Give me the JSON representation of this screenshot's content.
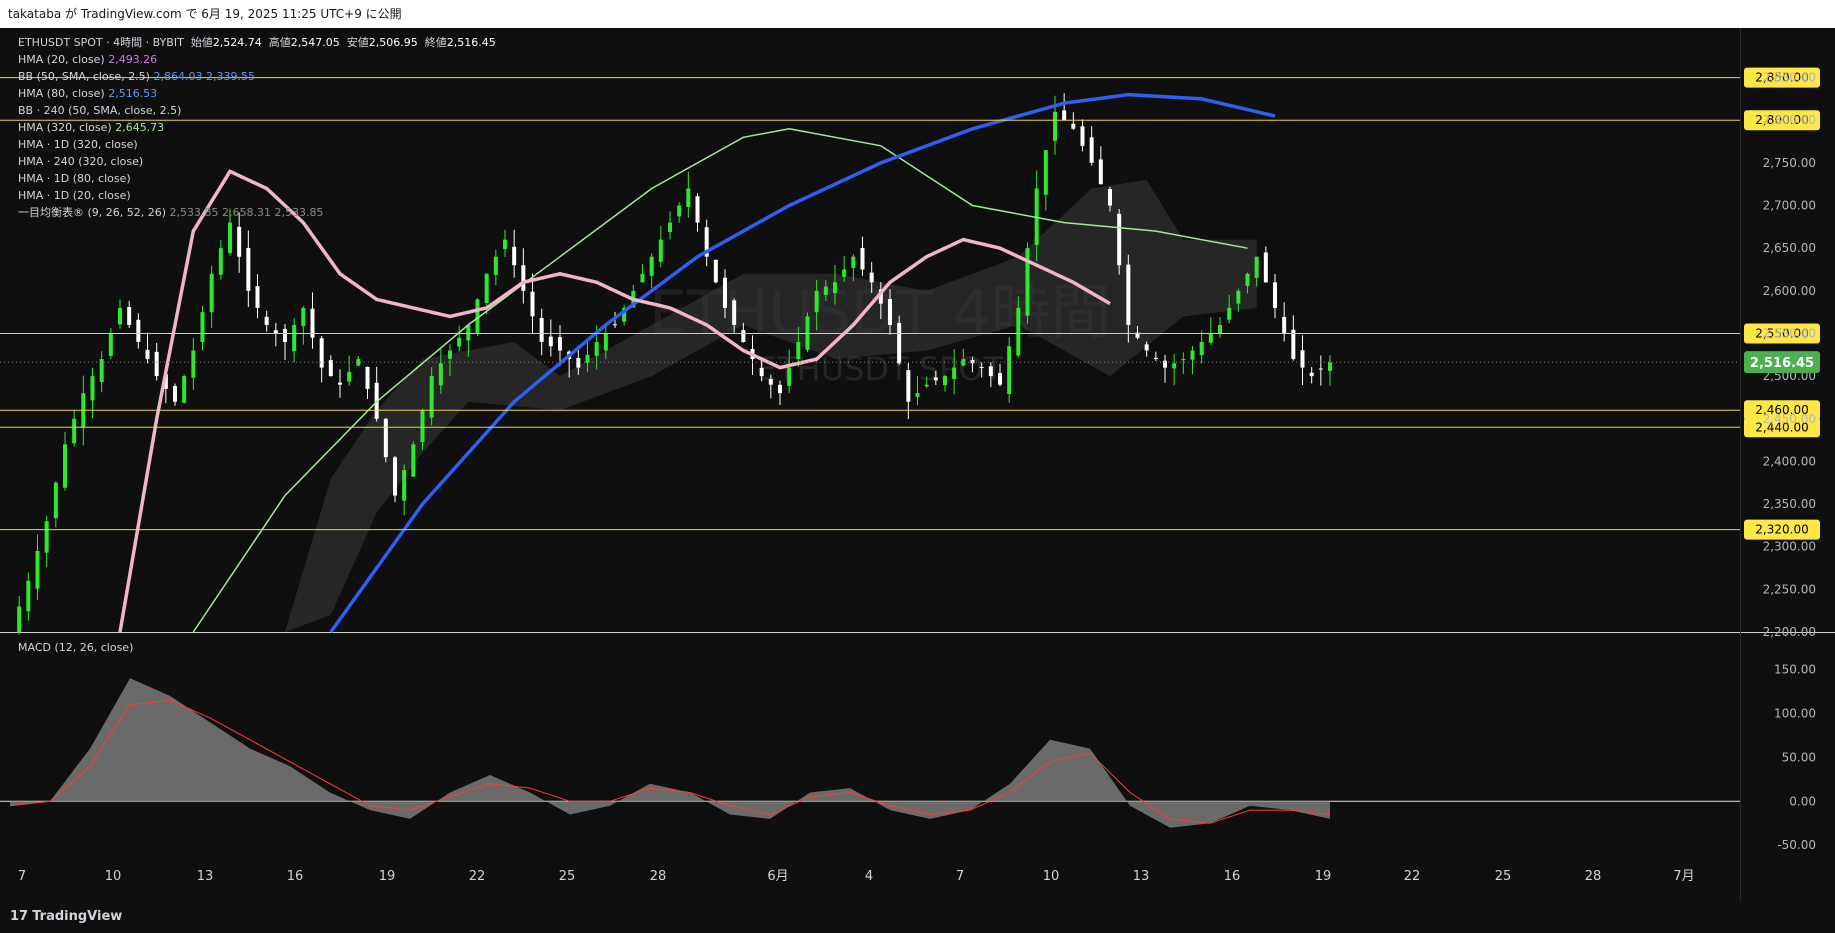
{
  "header": {
    "text": "takataba が TradingView.com で 6月 19, 2025 11:25 UTC+9 に公開"
  },
  "footer": {
    "brand": "TradingView",
    "logo": "tv-logo-icon"
  },
  "colors": {
    "background": "#0f0f0f",
    "up_candle": "#2ee82e",
    "down_candle": "#ffffff",
    "level_line": "#e8d44d",
    "level_label_bg": "#ffe745",
    "price_label_bg": "#4caf50",
    "hma20": "#c77dd9",
    "hma80": "#5b9cf0",
    "hma320": "#a5e89a",
    "hma1d320": "#2f5ff2",
    "hma1d80": "#f0b6c8",
    "bb": "#4a7ed0",
    "cloud": "#3a3a3a",
    "macd_hist": "#7a7a7a",
    "macd_signal": "#ff3b3b"
  },
  "legend": {
    "symbol": "ETHUSDT SPOT · 4時間 · BYBIT",
    "o_label": "始値",
    "o": "2,524.74",
    "h_label": "高値",
    "h": "2,547.05",
    "l_label": "安値",
    "l": "2,506.95",
    "c_label": "終値",
    "c": "2,516.45",
    "indicators": [
      {
        "name": "HMA (20, close)",
        "values": [
          "2,493.26"
        ],
        "color": "#c77dd9"
      },
      {
        "name": "BB (50, SMA, close, 2.5)",
        "values": [
          "2,864.03",
          "2,339.55"
        ],
        "color": "#5b9cf0"
      },
      {
        "name": "HMA (80, close)",
        "values": [
          "2,516.53"
        ],
        "color": "#5b9cf0"
      },
      {
        "name": "BB · 240 (50, SMA, close, 2.5)",
        "values": [],
        "color": "#5b9cf0"
      },
      {
        "name": "HMA (320, close)",
        "values": [
          "2,645.73"
        ],
        "color": "#a5e89a"
      },
      {
        "name": "HMA · 1D (320, close)",
        "values": [],
        "color": "#2f5ff2"
      },
      {
        "name": "HMA · 240 (320, close)",
        "values": [],
        "color": "#a5e89a"
      },
      {
        "name": "HMA · 1D (80, close)",
        "values": [],
        "color": "#f0b6c8"
      },
      {
        "name": "HMA · 1D (20, close)",
        "values": [],
        "color": "#c77dd9"
      },
      {
        "name": "一目均衡表® (9, 26, 52, 26)",
        "values": [
          "2,533.85",
          "2,658.31",
          "2,533.85"
        ],
        "color": "#8a8a8a"
      }
    ]
  },
  "watermark": {
    "big": "ETHUSDT 4時間",
    "small": "ETHUSDT SPOT"
  },
  "macd": {
    "title": "MACD (12, 26, close)"
  },
  "chart_data": [
    {
      "type": "candlestick",
      "title": "ETHUSDT SPOT · 4時間 · BYBIT",
      "x_labels": [
        "7",
        "10",
        "13",
        "16",
        "19",
        "22",
        "25",
        "28",
        "6月",
        "4",
        "7",
        "10",
        "13",
        "16",
        "19",
        "22",
        "25",
        "28",
        "7月"
      ],
      "y_ticks": [
        "2,200.00",
        "2,250.00",
        "2,300.00",
        "2,350.00",
        "2,400.00",
        "2,450.00",
        "2,500.00",
        "2,550.00",
        "2,600.00",
        "2,650.00",
        "2,700.00",
        "2,750.00",
        "2,800.00",
        "2,850.00"
      ],
      "ylim": [
        2200,
        2880
      ],
      "last_price": 2516.45,
      "last_price_label": "2,516.45",
      "levels": [
        {
          "value": 2850,
          "label": "2,850.00"
        },
        {
          "value": 2800,
          "label": "2,800.00"
        },
        {
          "value": 2550,
          "label": "2,550.00"
        },
        {
          "value": 2460,
          "label": "2,460.00"
        },
        {
          "value": 2440,
          "label": "2,440.00"
        },
        {
          "value": 2320,
          "label": "2,320.00"
        }
      ],
      "close_path": [
        [
          0,
          2200
        ],
        [
          2,
          2260
        ],
        [
          4,
          2330
        ],
        [
          6,
          2420
        ],
        [
          8,
          2480
        ],
        [
          10,
          2520
        ],
        [
          12,
          2580
        ],
        [
          14,
          2540
        ],
        [
          16,
          2500
        ],
        [
          18,
          2470
        ],
        [
          20,
          2530
        ],
        [
          22,
          2620
        ],
        [
          24,
          2680
        ],
        [
          26,
          2600
        ],
        [
          28,
          2560
        ],
        [
          30,
          2540
        ],
        [
          32,
          2580
        ],
        [
          34,
          2510
        ],
        [
          36,
          2490
        ],
        [
          38,
          2520
        ],
        [
          40,
          2450
        ],
        [
          42,
          2360
        ],
        [
          44,
          2420
        ],
        [
          46,
          2500
        ],
        [
          48,
          2530
        ],
        [
          50,
          2560
        ],
        [
          52,
          2620
        ],
        [
          54,
          2660
        ],
        [
          56,
          2600
        ],
        [
          58,
          2540
        ],
        [
          60,
          2530
        ],
        [
          62,
          2510
        ],
        [
          64,
          2540
        ],
        [
          66,
          2560
        ],
        [
          68,
          2600
        ],
        [
          70,
          2640
        ],
        [
          72,
          2680
        ],
        [
          74,
          2720
        ],
        [
          76,
          2640
        ],
        [
          78,
          2580
        ],
        [
          80,
          2540
        ],
        [
          82,
          2500
        ],
        [
          84,
          2480
        ],
        [
          86,
          2540
        ],
        [
          88,
          2600
        ],
        [
          90,
          2610
        ],
        [
          92,
          2640
        ],
        [
          94,
          2610
        ],
        [
          96,
          2560
        ],
        [
          98,
          2470
        ],
        [
          100,
          2490
        ],
        [
          102,
          2500
        ],
        [
          104,
          2520
        ],
        [
          106,
          2510
        ],
        [
          108,
          2490
        ],
        [
          110,
          2580
        ],
        [
          112,
          2720
        ],
        [
          114,
          2810
        ],
        [
          116,
          2790
        ],
        [
          118,
          2750
        ],
        [
          120,
          2700
        ],
        [
          122,
          2560
        ],
        [
          124,
          2530
        ],
        [
          126,
          2510
        ],
        [
          128,
          2520
        ],
        [
          130,
          2540
        ],
        [
          132,
          2560
        ],
        [
          134,
          2600
        ],
        [
          136,
          2640
        ],
        [
          138,
          2580
        ],
        [
          140,
          2520
        ],
        [
          142,
          2500
        ],
        [
          144,
          2516
        ]
      ],
      "hma_1d_80": [
        [
          12,
          2200
        ],
        [
          16,
          2450
        ],
        [
          20,
          2670
        ],
        [
          24,
          2740
        ],
        [
          28,
          2720
        ],
        [
          32,
          2680
        ],
        [
          36,
          2620
        ],
        [
          40,
          2590
        ],
        [
          44,
          2580
        ],
        [
          48,
          2570
        ],
        [
          52,
          2580
        ],
        [
          56,
          2610
        ],
        [
          60,
          2620
        ],
        [
          64,
          2610
        ],
        [
          68,
          2590
        ],
        [
          72,
          2580
        ],
        [
          76,
          2560
        ],
        [
          80,
          2530
        ],
        [
          84,
          2510
        ],
        [
          88,
          2520
        ],
        [
          92,
          2560
        ],
        [
          96,
          2610
        ],
        [
          100,
          2640
        ],
        [
          104,
          2660
        ],
        [
          108,
          2650
        ],
        [
          112,
          2630
        ],
        [
          116,
          2610
        ],
        [
          120,
          2585
        ]
      ],
      "hma_1d_320": [
        [
          35,
          2200
        ],
        [
          45,
          2350
        ],
        [
          55,
          2470
        ],
        [
          65,
          2560
        ],
        [
          75,
          2640
        ],
        [
          85,
          2700
        ],
        [
          95,
          2750
        ],
        [
          105,
          2790
        ],
        [
          115,
          2820
        ],
        [
          122,
          2830
        ],
        [
          130,
          2825
        ],
        [
          138,
          2805
        ]
      ],
      "hma_320": [
        [
          20,
          2200
        ],
        [
          30,
          2360
        ],
        [
          40,
          2470
        ],
        [
          50,
          2560
        ],
        [
          60,
          2640
        ],
        [
          70,
          2720
        ],
        [
          80,
          2780
        ],
        [
          85,
          2790
        ],
        [
          95,
          2770
        ],
        [
          105,
          2700
        ],
        [
          115,
          2680
        ],
        [
          125,
          2670
        ],
        [
          135,
          2650
        ]
      ],
      "macd_ylim": [
        -60,
        170
      ],
      "macd_ticks": [
        "150.00",
        "100.00",
        "50.00",
        "0.00",
        "-50.00"
      ],
      "macd_hist": [
        [
          0,
          -5
        ],
        [
          4,
          0
        ],
        [
          8,
          60
        ],
        [
          12,
          140
        ],
        [
          16,
          120
        ],
        [
          20,
          90
        ],
        [
          24,
          60
        ],
        [
          28,
          40
        ],
        [
          32,
          10
        ],
        [
          36,
          -10
        ],
        [
          40,
          -20
        ],
        [
          44,
          10
        ],
        [
          48,
          30
        ],
        [
          52,
          10
        ],
        [
          56,
          -15
        ],
        [
          60,
          -5
        ],
        [
          64,
          20
        ],
        [
          68,
          10
        ],
        [
          72,
          -15
        ],
        [
          76,
          -20
        ],
        [
          80,
          10
        ],
        [
          84,
          15
        ],
        [
          88,
          -10
        ],
        [
          92,
          -20
        ],
        [
          96,
          -10
        ],
        [
          100,
          20
        ],
        [
          104,
          70
        ],
        [
          108,
          60
        ],
        [
          112,
          -5
        ],
        [
          116,
          -30
        ],
        [
          120,
          -25
        ],
        [
          124,
          -5
        ],
        [
          128,
          -10
        ],
        [
          132,
          -20
        ]
      ],
      "macd_signal": [
        [
          0,
          -5
        ],
        [
          4,
          0
        ],
        [
          8,
          40
        ],
        [
          12,
          110
        ],
        [
          16,
          115
        ],
        [
          20,
          95
        ],
        [
          24,
          70
        ],
        [
          28,
          45
        ],
        [
          32,
          20
        ],
        [
          36,
          -5
        ],
        [
          40,
          -10
        ],
        [
          44,
          5
        ],
        [
          48,
          20
        ],
        [
          52,
          15
        ],
        [
          56,
          0
        ],
        [
          60,
          0
        ],
        [
          64,
          15
        ],
        [
          68,
          10
        ],
        [
          72,
          -5
        ],
        [
          76,
          -15
        ],
        [
          80,
          5
        ],
        [
          84,
          10
        ],
        [
          88,
          -5
        ],
        [
          92,
          -15
        ],
        [
          96,
          -10
        ],
        [
          100,
          10
        ],
        [
          104,
          45
        ],
        [
          108,
          55
        ],
        [
          112,
          10
        ],
        [
          116,
          -20
        ],
        [
          120,
          -25
        ],
        [
          124,
          -10
        ],
        [
          128,
          -10
        ],
        [
          132,
          -15
        ]
      ]
    }
  ]
}
